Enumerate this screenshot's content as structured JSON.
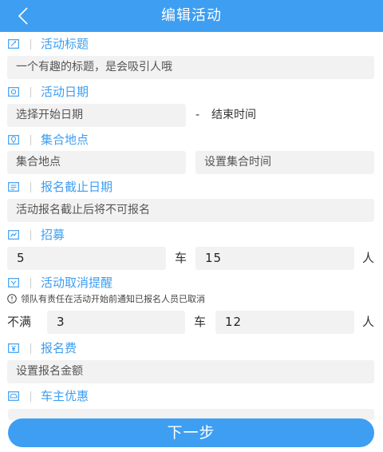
{
  "header": {
    "title": "编辑活动",
    "back_icon": "chevron-left-icon"
  },
  "colors": {
    "accent": "#3e9ef1",
    "field_bg": "#f2f2f2"
  },
  "sections": {
    "title": {
      "label": "活动标题",
      "placeholder": "一个有趣的标题，是会吸引人哦"
    },
    "date": {
      "label": "活动日期",
      "start_placeholder": "选择开始日期",
      "separator": "-",
      "end_placeholder": "结束时间"
    },
    "meet": {
      "label": "集合地点",
      "place_placeholder": "集合地点",
      "time_placeholder": "设置集合时间"
    },
    "deadline": {
      "label": "报名截止日期",
      "placeholder": "活动报名截止后将不可报名"
    },
    "recruit": {
      "label": "招募",
      "cars": "5",
      "car_unit": "车",
      "people": "15",
      "people_unit": "人"
    },
    "cancel": {
      "label": "活动取消提醒",
      "notice": "领队有责任在活动开始前通知已报名人员已取消",
      "prefix": "不满",
      "cars": "3",
      "car_unit": "车",
      "people": "12",
      "people_unit": "人"
    },
    "fee": {
      "label": "报名费",
      "placeholder": "设置报名金额"
    },
    "owner": {
      "label": "车主优惠"
    }
  },
  "footer": {
    "next_label": "下一步"
  }
}
